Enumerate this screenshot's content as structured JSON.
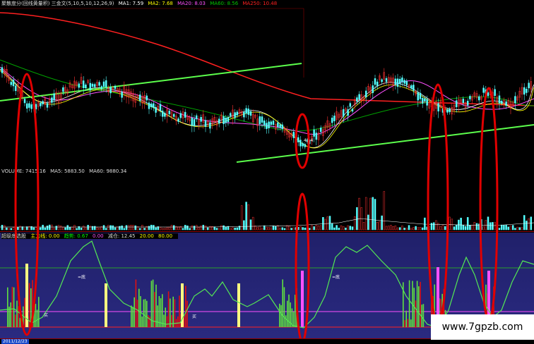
{
  "kline_header": {
    "title": "聚散度分(回线黄量积) 三金文(5,10,5,10,12,26,9)",
    "ma1": "MA1: 7.59",
    "ma2": "MA2: 7.68",
    "ma20": "MA20: 8.03",
    "ma60": "MA60: 8.56",
    "ma250": "MA250: 10.48",
    "low_label": "4.14"
  },
  "volume_header": {
    "volume": "VOLUME: 7415.16",
    "ma5": "MA5: 5883.50",
    "ma60": "MA60: 9880.34"
  },
  "indicator_header": {
    "title": "超级底选股",
    "field1": "主力线: 0.00",
    "field2": "趋势: 0.67",
    "field3": "0.00",
    "field4": "减仓: 12.45",
    "field5": "20.00",
    "field6": "80.00",
    "marker_label": "=底",
    "bottom_label": "买"
  },
  "date_label": "2011/12/23",
  "watermark": "www.7gpzb.com",
  "colors": {
    "up": "#ff3232",
    "down": "#54ffff",
    "ma_white": "#ffffff",
    "ma_yellow": "#ffff00",
    "ma_magenta": "#ff50ff",
    "ma_green": "#00c800",
    "ma_red": "#ff2020",
    "trend_green": "#5cff4c",
    "highlight_red": "#e00000"
  }
}
